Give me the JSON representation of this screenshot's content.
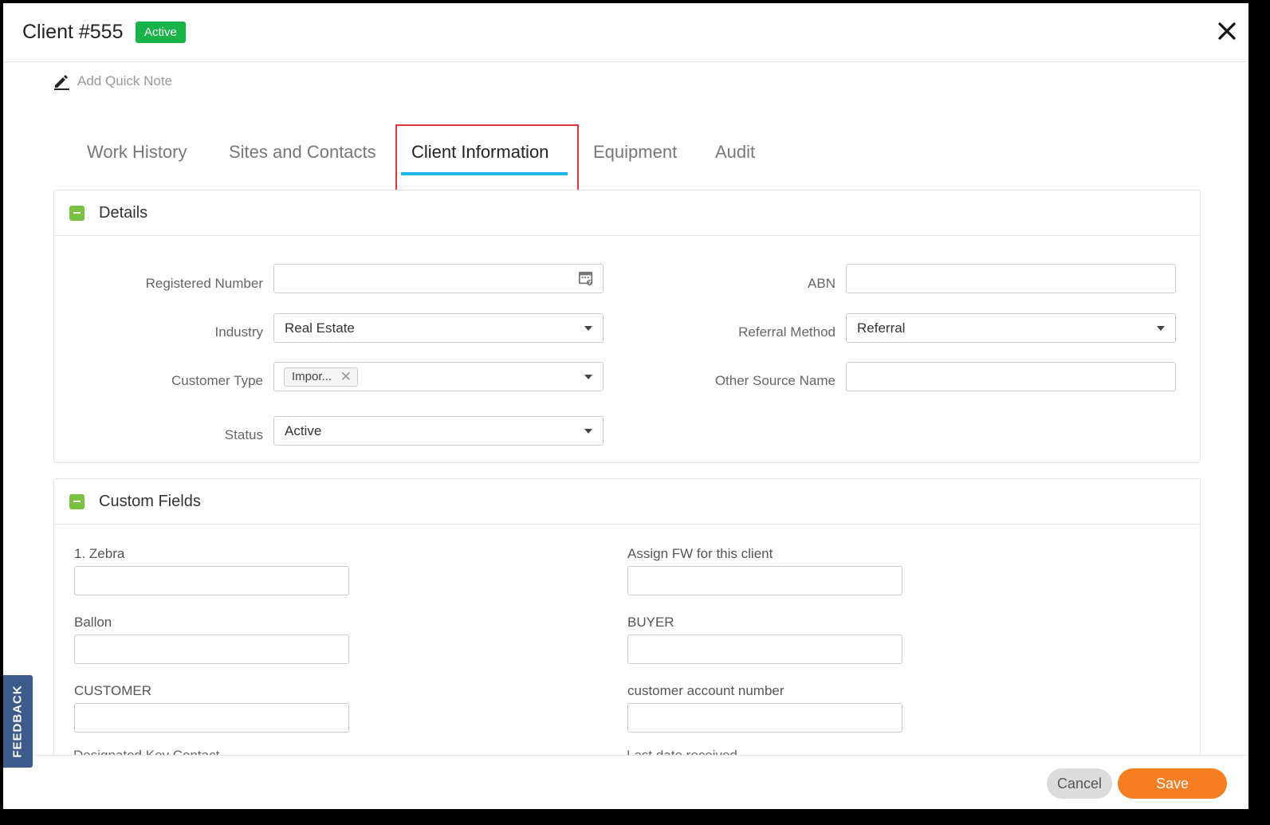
{
  "header": {
    "title": "Client #555",
    "status_badge": "Active"
  },
  "quick_note": {
    "label": "Add Quick Note"
  },
  "tabs": [
    {
      "label": "Work History"
    },
    {
      "label": "Sites and Contacts"
    },
    {
      "label": "Client Information",
      "active": true
    },
    {
      "label": "Equipment"
    },
    {
      "label": "Audit"
    }
  ],
  "details": {
    "title": "Details",
    "registered_number": {
      "label": "Registered Number",
      "value": ""
    },
    "abn": {
      "label": "ABN",
      "value": ""
    },
    "industry": {
      "label": "Industry",
      "value": "Real Estate"
    },
    "referral_method": {
      "label": "Referral Method",
      "value": "Referral"
    },
    "customer_type": {
      "label": "Customer Type",
      "tag": "Impor..."
    },
    "other_source_name": {
      "label": "Other Source Name",
      "value": ""
    },
    "status": {
      "label": "Status",
      "value": "Active"
    }
  },
  "custom_fields": {
    "title": "Custom Fields",
    "fields": [
      {
        "label": "1. Zebra",
        "value": ""
      },
      {
        "label": "Assign FW for this client",
        "value": ""
      },
      {
        "label": "Ballon",
        "value": ""
      },
      {
        "label": "BUYER",
        "value": ""
      },
      {
        "label": "CUSTOMER",
        "value": ""
      },
      {
        "label": "customer account number",
        "value": ""
      }
    ],
    "partial_labels": [
      "Designated Key Contact",
      "Last date received"
    ]
  },
  "footer": {
    "cancel_label": "Cancel",
    "save_label": "Save"
  },
  "feedback": {
    "label": "FEEDBACK"
  },
  "colors": {
    "active_badge": "#18b44a",
    "tab_underline": "#1fb7e8",
    "tab_highlight": "#e2353b",
    "toggle_green": "#7ac142",
    "save": "#f57e22",
    "feedback": "#3c5b8a"
  }
}
